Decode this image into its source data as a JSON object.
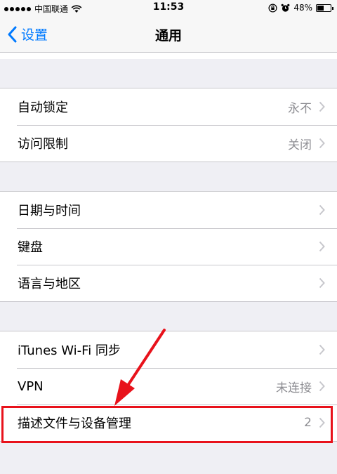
{
  "status_bar": {
    "carrier": "中国联通",
    "time": "11:53",
    "battery": "48%",
    "battery_level": 0.48
  },
  "nav": {
    "back_label": "设置",
    "title": "通用"
  },
  "groups": [
    [
      {
        "label": "自动锁定",
        "value": "永不"
      },
      {
        "label": "访问限制",
        "value": "关闭"
      }
    ],
    [
      {
        "label": "日期与时间",
        "value": ""
      },
      {
        "label": "键盘",
        "value": ""
      },
      {
        "label": "语言与地区",
        "value": ""
      }
    ],
    [
      {
        "label": "iTunes Wi-Fi 同步",
        "value": ""
      },
      {
        "label": "VPN",
        "value": "未连接"
      },
      {
        "label": "描述文件与设备管理",
        "value": "2"
      }
    ]
  ],
  "colors": {
    "accent": "#007aff",
    "highlight": "#e8121b",
    "background": "#efeff4",
    "secondary_text": "#8e8e93"
  },
  "icons": [
    "wifi-icon",
    "back-chevron-icon",
    "chevron-right-icon",
    "rotation-lock-icon",
    "alarm-icon",
    "battery-icon"
  ]
}
